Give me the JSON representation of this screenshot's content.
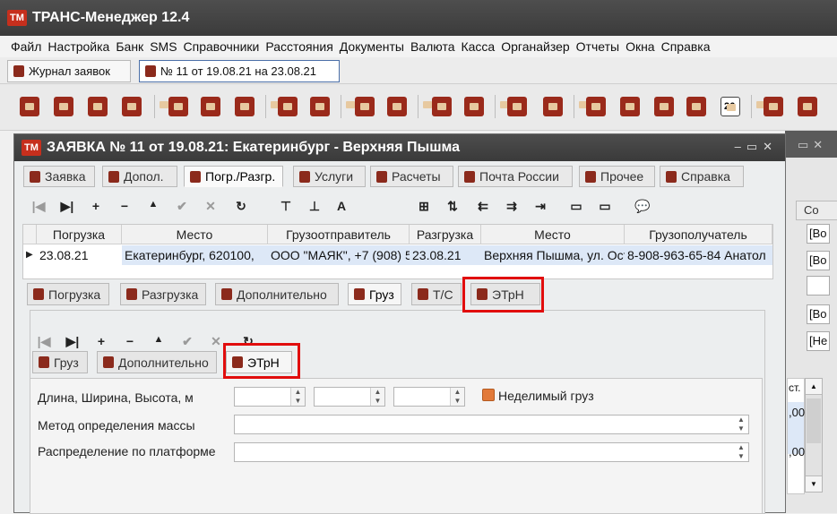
{
  "app": {
    "title": "ТРАНС-Менеджер 12.4",
    "logo_text": "ТМ"
  },
  "menu": [
    "Файл",
    "Настройка",
    "Банк",
    "SMS",
    "Справочники",
    "Расстояния",
    "Документы",
    "Валюта",
    "Касса",
    "Органайзер",
    "Отчеты",
    "Окна",
    "Справка"
  ],
  "doc_tabs": [
    {
      "label": "Журнал заявок"
    },
    {
      "label": "№ 11 от 19.08.21 на 23.08.21"
    }
  ],
  "toolbar_icons": [
    "doc-add-icon",
    "house-add-icon",
    "truck-add-icon",
    "person-add-icon",
    "book-icon",
    "house-icon",
    "truck-icon",
    "car-icon",
    "steering-wheel-icon",
    "eye-icon",
    "ruler-icon",
    "calculator-icon",
    "binders-icon",
    "scales-icon",
    "scales-arrow-icon",
    "film-icon",
    "id-card-icon",
    "people-add-icon",
    "handshake-icon",
    "calendar-icon",
    "sort-icon",
    "boxes-icon"
  ],
  "calendar_day": "26",
  "dialog": {
    "title": "ЗАЯВКА № 11 от 19.08.21: Екатеринбург - Верхняя Пышма",
    "tabs": [
      "Заявка",
      "Допол.",
      "Погр./Разгр.",
      "Услуги",
      "Расчеты",
      "Почта России",
      "Прочее",
      "Справка"
    ],
    "nav_icons": [
      "|◀",
      "▶|",
      "+",
      "−",
      "▲",
      "✔",
      "✕",
      "↻"
    ],
    "align_icons": [
      "⊤",
      "⊥",
      "A",
      "⊞",
      "⇅",
      "⇇",
      "⇉",
      "⇥",
      "▭",
      "▭",
      "💬"
    ]
  },
  "grid": {
    "headers": [
      "Погрузка",
      "Место",
      "Грузоотправитель",
      "Разгрузка",
      "Место",
      "Грузополучатель"
    ],
    "rows": [
      [
        "23.08.21",
        "Екатеринбург, 620100,",
        "ООО \"МАЯК\", +7 (908) 5",
        "23.08.21",
        "Верхняя Пышма, ул. Ост",
        "8-908-963-65-84 Анатол"
      ]
    ]
  },
  "subtabs": [
    "Погрузка",
    "Разгрузка",
    "Дополнительно",
    "Груз",
    "Т/С",
    "ЭТрН"
  ],
  "cargo_nav_icons": [
    "|◀",
    "▶|",
    "+",
    "−",
    "▲",
    "✔",
    "✕",
    "↻"
  ],
  "inner_tabs": [
    "Груз",
    "Дополнительно",
    "ЭТрН"
  ],
  "form": {
    "dims_label": "Длина, Ширина, Высота, м",
    "indivisible_label": "Неделимый груз",
    "mass_method_label": "Метод определения массы",
    "platform_label": "Распределение по платформе",
    "dims_values": [
      "",
      "",
      ""
    ],
    "mass_method_value": "",
    "platform_value": ""
  },
  "side": {
    "partial_label": "Со",
    "fields": [
      "[Во",
      "[Во",
      "",
      "[Во",
      "[Не"
    ],
    "col_label": "ст.",
    "values": [
      ",00",
      ",00"
    ]
  },
  "colors": {
    "highlight": "#e10d0d",
    "accent": "#8b2a1c",
    "titlebar": "#444444",
    "selection": "#dde8f7"
  }
}
